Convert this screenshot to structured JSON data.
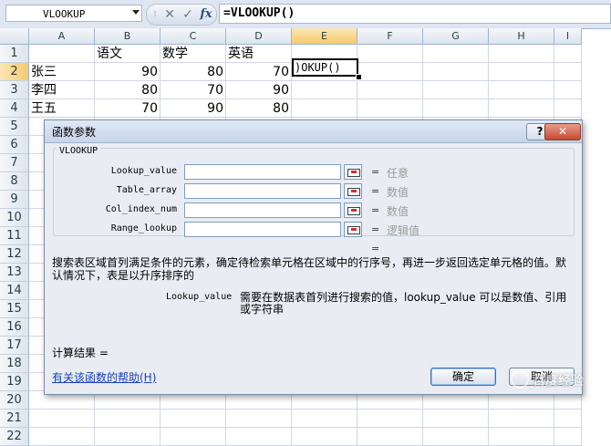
{
  "formula_bar": {
    "name_box": "VLOOKUP",
    "cancel_glyph": "✕",
    "enter_glyph": "✓",
    "fx_label": "fx",
    "formula": "=VLOOKUP()"
  },
  "grid": {
    "columns": [
      "A",
      "B",
      "C",
      "D",
      "E",
      "F",
      "G",
      "H",
      "I"
    ],
    "rows": [
      "1",
      "2",
      "3",
      "4",
      "5",
      "6",
      "7",
      "8",
      "9",
      "10",
      "11",
      "12",
      "13",
      "14",
      "15",
      "16",
      "17",
      "18",
      "19",
      "20",
      "21",
      "22"
    ],
    "selected_column": "E",
    "selected_row": "2",
    "header_row": [
      "",
      "语文",
      "数学",
      "英语"
    ],
    "data_rows": [
      [
        "张三",
        "90",
        "80",
        "70"
      ],
      [
        "李四",
        "80",
        "70",
        "90"
      ],
      [
        "王五",
        "70",
        "90",
        "80"
      ]
    ],
    "active_cell_text": ")OKUP()"
  },
  "dialog": {
    "title": "函数参数",
    "help_glyph": "?",
    "close_glyph": "✕",
    "function_name": "VLOOKUP",
    "args": [
      {
        "label": "Lookup_value",
        "eq": "=",
        "value": "任意"
      },
      {
        "label": "Table_array",
        "eq": "=",
        "value": "数值"
      },
      {
        "label": "Col_index_num",
        "eq": "=",
        "value": "数值"
      },
      {
        "label": "Range_lookup",
        "eq": "=",
        "value": "逻辑值"
      }
    ],
    "result_eq": "=",
    "description": "搜索表区域首列满足条件的元素，确定待检索单元格在区域中的行序号，再进一步返回选定单元格的值。默认情况下，表是以升序排序的",
    "param_name": "Lookup_value",
    "param_description": "需要在数据表首列进行搜索的值，lookup_value 可以是数值、引用或字符串",
    "calc_result": "计算结果 =",
    "help_link": "有关该函数的帮助(H)",
    "ok_label": "确定",
    "cancel_label": "取消"
  },
  "watermark": {
    "text": "百度经验",
    "icon": "baidu-paw-icon"
  }
}
